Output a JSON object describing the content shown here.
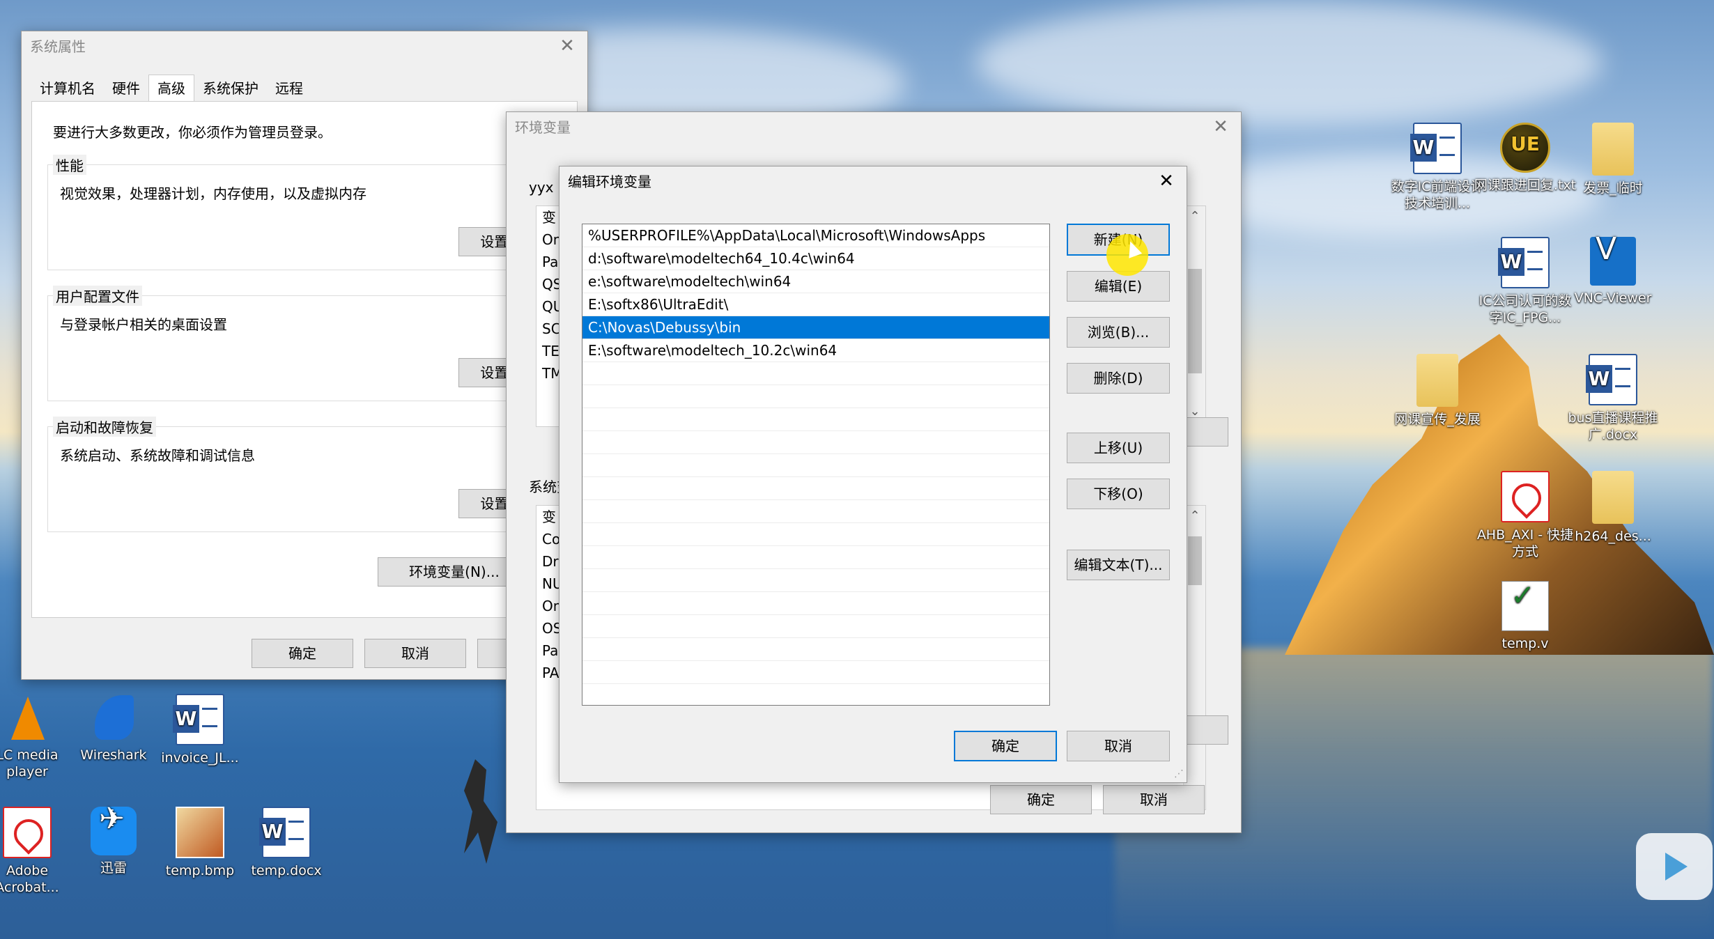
{
  "desktop": {
    "icons_right": [
      {
        "label": "数字IC前端设计技术培训...",
        "type": "word"
      },
      {
        "label": "网课跟进回复.txt",
        "type": "ue"
      },
      {
        "label": "发票_临时",
        "type": "folder"
      },
      {
        "label": "IC公司认可的数字IC_FPG...",
        "type": "word"
      },
      {
        "label": "VNC-Viewer",
        "type": "vnc"
      },
      {
        "label": "网课宣传_发展",
        "type": "folder"
      },
      {
        "label": "bus直播课程推广.docx",
        "type": "word"
      },
      {
        "label": "AHB_AXI - 快捷方式",
        "type": "pdf"
      },
      {
        "label": "h264_des...",
        "type": "folder"
      },
      {
        "label": "temp.v",
        "type": "vfile"
      }
    ],
    "icons_bottom": [
      {
        "label": "LC media player",
        "type": "vlc"
      },
      {
        "label": "Wireshark",
        "type": "shark"
      },
      {
        "label": "invoice_JL...",
        "type": "word"
      },
      {
        "label": "Adobe Acrobat...",
        "type": "pdf"
      },
      {
        "label": "迅雷",
        "type": "xunlei"
      },
      {
        "label": "temp.bmp",
        "type": "bmp"
      },
      {
        "label": "temp.docx",
        "type": "word"
      }
    ]
  },
  "sysprops": {
    "title": "系统属性",
    "tabs": [
      "计算机名",
      "硬件",
      "高级",
      "系统保护",
      "远程"
    ],
    "active_tab": "高级",
    "admin_note": "要进行大多数更改，你必须作为管理员登录。",
    "perf_title": "性能",
    "perf_desc": "视觉效果，处理器计划，内存使用，以及虚拟内存",
    "perf_btn": "设置(S)...",
    "profile_title": "用户配置文件",
    "profile_desc": "与登录帐户相关的桌面设置",
    "profile_btn": "设置(E)...",
    "startup_title": "启动和故障恢复",
    "startup_desc": "系统启动、系统故障和调试信息",
    "startup_btn": "设置(T)...",
    "envvars_btn": "环境变量(N)...",
    "ok": "确定",
    "cancel": "取消"
  },
  "envvars": {
    "title": "环境变量",
    "user_section": "yyx 的用户变量(U)",
    "user_rows": [
      "变",
      "On",
      "Pa",
      "QS",
      "QU",
      "SC",
      "TE",
      "TM"
    ],
    "system_section": "系统变量(S)",
    "system_rows": [
      "变",
      "Co",
      "Dr",
      "NU",
      "On",
      "OS",
      "Pa",
      "PA"
    ],
    "ok": "确定",
    "cancel": "取消"
  },
  "editenv": {
    "title": "编辑环境变量",
    "entries": [
      "%USERPROFILE%\\AppData\\Local\\Microsoft\\WindowsApps",
      "d:\\software\\modeltech64_10.4c\\win64",
      "e:\\software\\modeltech\\win64",
      "E:\\softx86\\UltraEdit\\",
      "C:\\Novas\\Debussy\\bin",
      "E:\\software\\modeltech_10.2c\\win64"
    ],
    "selected_index": 4,
    "buttons": {
      "new": "新建(N)",
      "edit": "编辑(E)",
      "browse": "浏览(B)...",
      "delete": "删除(D)",
      "up": "上移(U)",
      "down": "下移(O)",
      "edit_text": "编辑文本(T)..."
    },
    "ok": "确定",
    "cancel": "取消"
  }
}
